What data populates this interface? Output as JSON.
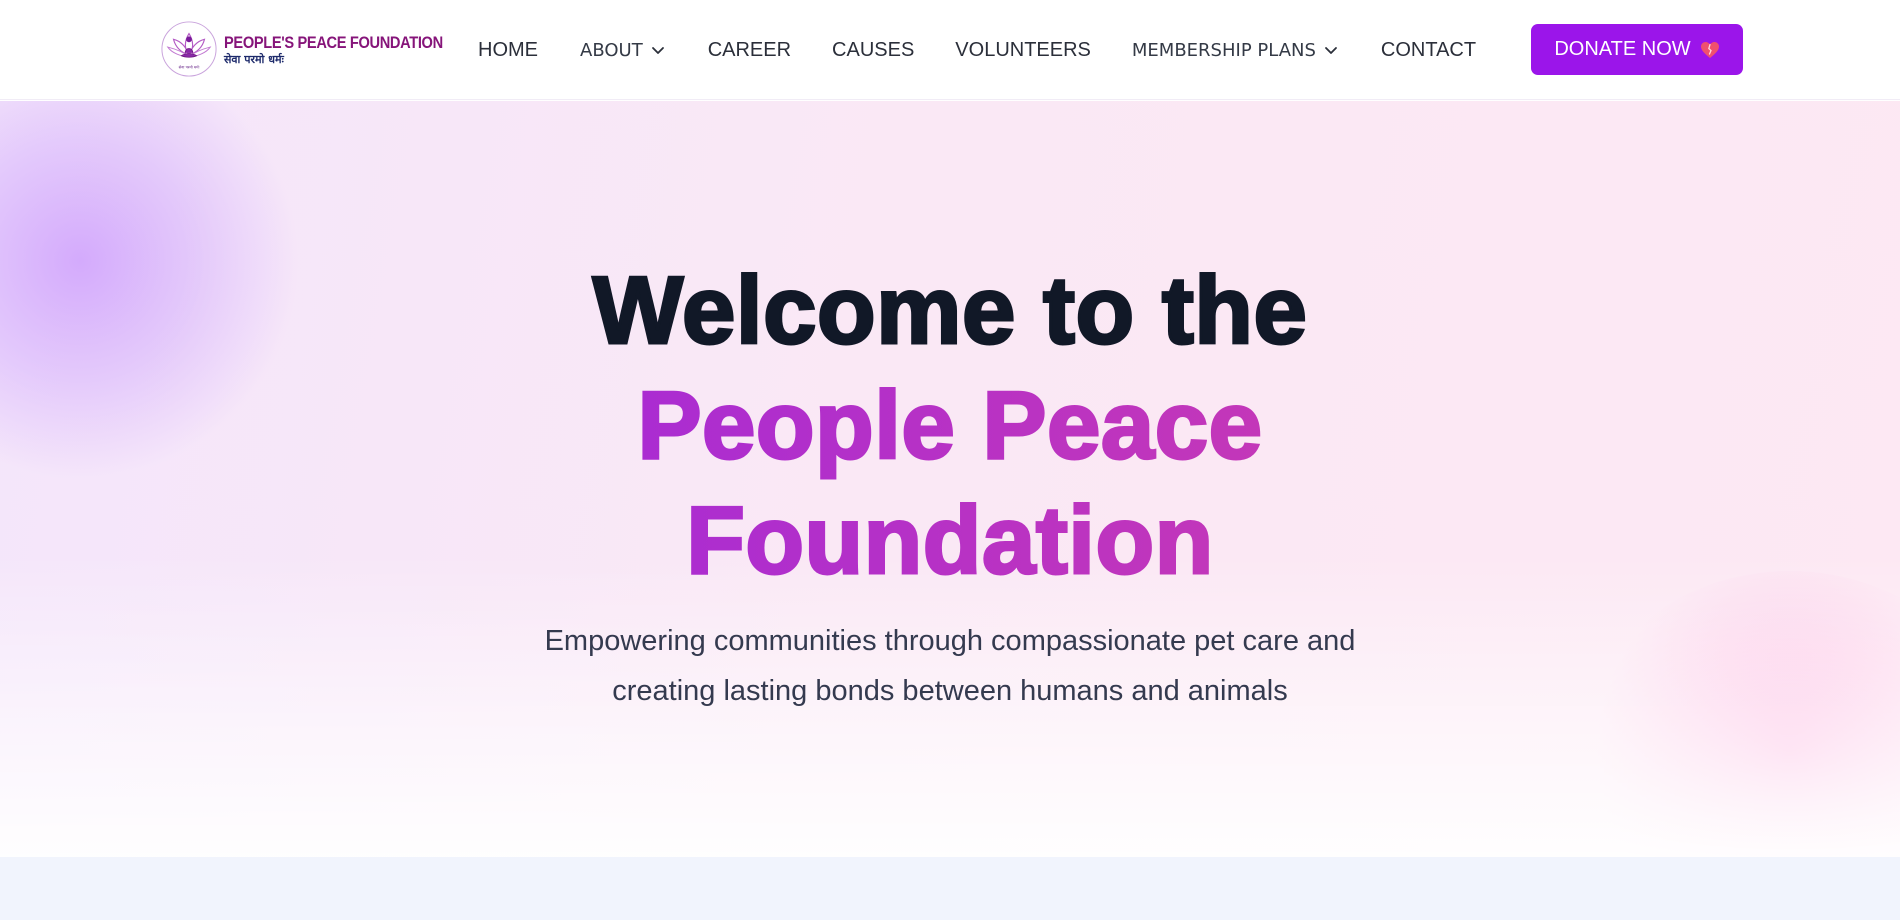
{
  "header": {
    "logo": {
      "title": "PEOPLE'S PEACE FOUNDATION",
      "subtitle": "सेवा परमो धर्मः",
      "emblem_text": "सेवा परमो धर्मः",
      "icon": "lotus-meditation-logo"
    },
    "nav": [
      {
        "label": "HOME",
        "has_dropdown": false
      },
      {
        "label": "ABOUT",
        "has_dropdown": true
      },
      {
        "label": "CAREER",
        "has_dropdown": false
      },
      {
        "label": "CAUSES",
        "has_dropdown": false
      },
      {
        "label": "VOLUNTEERS",
        "has_dropdown": false
      },
      {
        "label": "MEMBERSHIP PLANS",
        "has_dropdown": true
      },
      {
        "label": "CONTACT",
        "has_dropdown": false
      }
    ],
    "donate": {
      "label": "DONATE NOW",
      "icon": "heart-icon",
      "color": "#9b15ea"
    }
  },
  "hero": {
    "title_line1": "Welcome to the",
    "title_line2": "People Peace",
    "title_line3": "Foundation",
    "subtitle_line1": "Empowering communities through compassionate pet care and",
    "subtitle_line2": "creating lasting bonds between humans and animals"
  },
  "colors": {
    "brand_purple": "#9b15ea",
    "title_dark": "#111827",
    "title_gradient_start": "#a82bd4",
    "title_gradient_end": "#c638b6",
    "logo_title": "#86157a"
  }
}
